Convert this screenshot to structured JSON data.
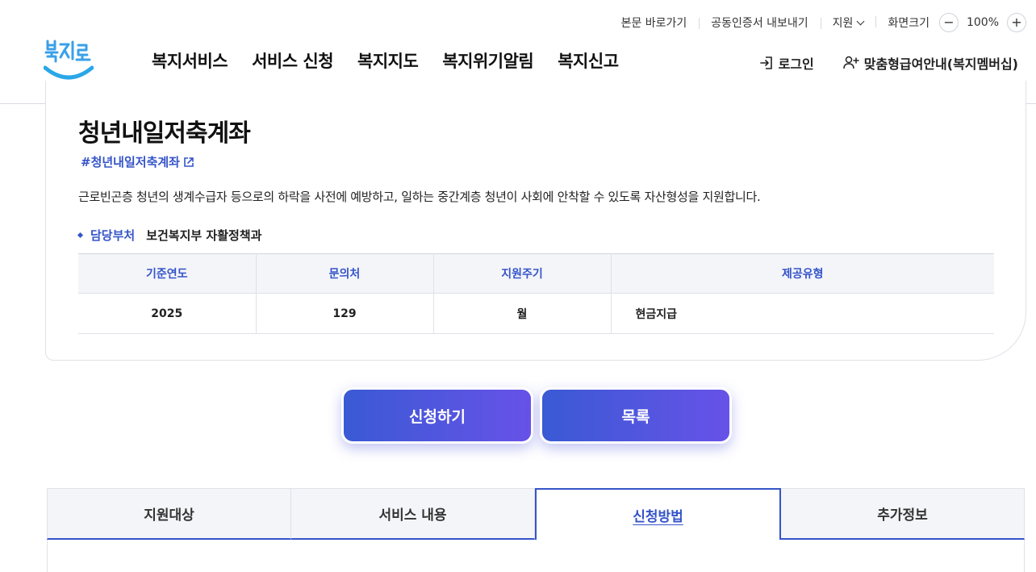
{
  "header": {
    "util": {
      "skip_to_content": "본문 바로가기",
      "export_certificate": "공동인증서 내보내기",
      "support": "지원",
      "screen_size_label": "화면크기",
      "zoom_out": "−",
      "zoom_value": "100%",
      "zoom_in": "+"
    },
    "logo_text": "복지로",
    "nav": [
      "복지서비스",
      "서비스 신청",
      "복지지도",
      "복지위기알림",
      "복지신고"
    ],
    "login": "로그인",
    "membership": "맞춤형급여안내(복지멤버십)",
    "brand_color": "#3554c9"
  },
  "service": {
    "title": "청년내일저축계좌",
    "tag": "#청년내일저축계좌",
    "description": "근로빈곤층 청년의 생계수급자 등으로의 하락을 사전에 예방하고, 일하는 중간계층 청년이 사회에 안착할 수 있도록 자산형성을 지원합니다.",
    "dept_label": "담당부처",
    "dept_value": "보건복지부 자활정책과",
    "table": {
      "headers": [
        "기준연도",
        "문의처",
        "지원주기",
        "제공유형"
      ],
      "row": [
        "2025",
        "129",
        "월",
        "현금지급"
      ]
    }
  },
  "actions": {
    "apply": "신청하기",
    "list": "목록"
  },
  "tabs": [
    {
      "label": "지원대상",
      "active": false
    },
    {
      "label": "서비스 내용",
      "active": false
    },
    {
      "label": "신청방법",
      "active": true
    },
    {
      "label": "추가정보",
      "active": false
    }
  ]
}
